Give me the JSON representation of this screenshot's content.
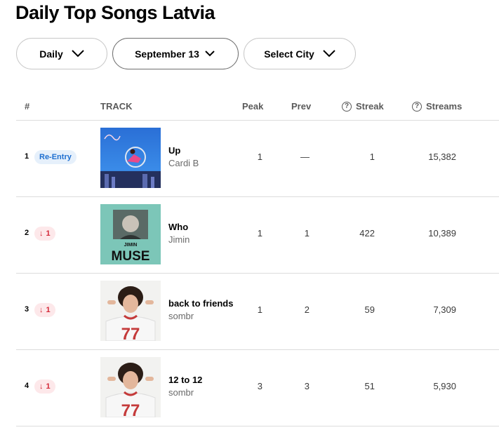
{
  "page": {
    "title": "Daily Top Songs Latvia"
  },
  "filters": {
    "period": "Daily",
    "date": "September 13",
    "city": "Select City"
  },
  "table": {
    "headers": {
      "rank": "#",
      "track": "TRACK",
      "peak": "Peak",
      "prev": "Prev",
      "streak": "Streak",
      "streams": "Streams"
    },
    "rows": [
      {
        "rank": "1",
        "badge": "Re-Entry",
        "title": "Up",
        "artist": "Cardi B",
        "peak": "1",
        "prev": "—",
        "streak": "1",
        "streams": "15,382"
      },
      {
        "rank": "2",
        "badge": "1",
        "title": "Who",
        "artist": "Jimin",
        "peak": "1",
        "prev": "1",
        "streak": "422",
        "streams": "10,389"
      },
      {
        "rank": "3",
        "badge": "1",
        "title": "back to friends",
        "artist": "sombr",
        "peak": "1",
        "prev": "2",
        "streak": "59",
        "streams": "7,309"
      },
      {
        "rank": "4",
        "badge": "1",
        "title": "12 to 12",
        "artist": "sombr",
        "peak": "3",
        "prev": "3",
        "streak": "51",
        "streams": "5,930"
      }
    ]
  },
  "covers": {
    "row2": {
      "text_top": "JIMIN",
      "text_main": "MUSE"
    },
    "row3": {
      "jersey_number": "77"
    },
    "row4": {
      "jersey_number": "77"
    }
  },
  "colors": {
    "reentry_text": "#1e6fd0",
    "reentry_bg": "#e6f0fb",
    "down_text": "#d42838",
    "down_bg": "#fde8ea"
  },
  "icons": {
    "chevron": "chevron-down-icon",
    "info": "info-circle-icon",
    "down_arrow": "arrow-down-icon"
  }
}
